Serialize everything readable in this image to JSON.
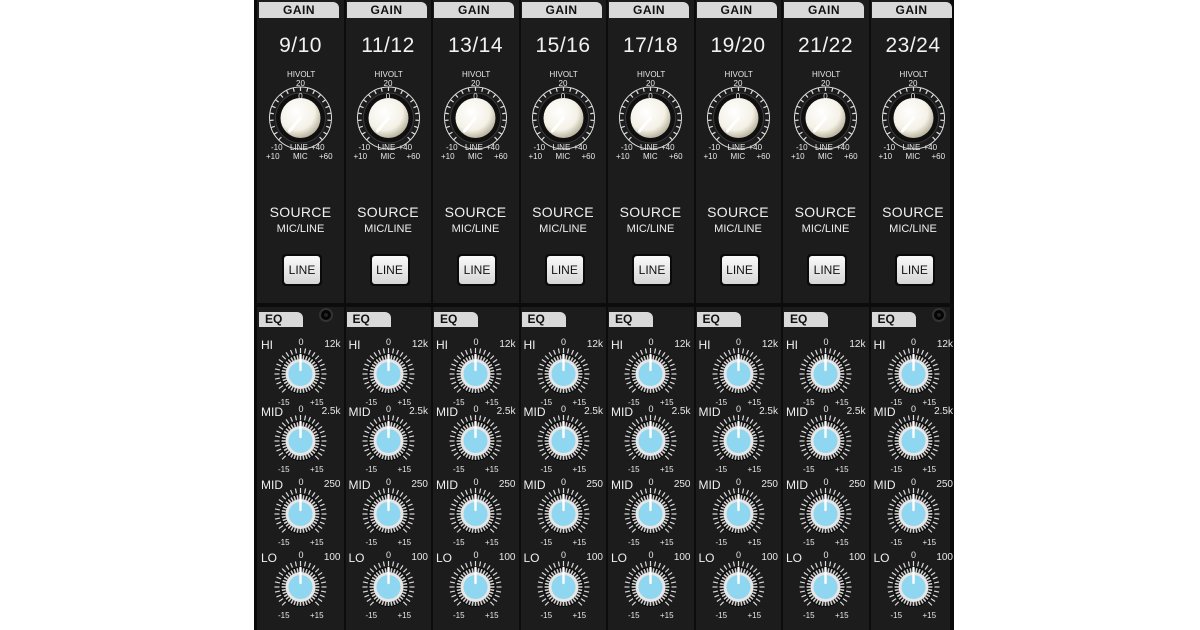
{
  "gain_section": {
    "tab_label": "GAIN",
    "hivolt_label": "HIVOLT",
    "top_value": "20",
    "zero_value": "0",
    "line_min": "-10",
    "line_label": "LINE",
    "line_max": "+40",
    "mic_min": "+10",
    "mic_label": "MIC",
    "mic_max": "+60"
  },
  "source_section": {
    "title": "SOURCE",
    "subtitle": "MIC/LINE",
    "button_label": "LINE"
  },
  "eq_section": {
    "tab_label": "EQ",
    "zero": "0",
    "min": "-15",
    "max": "+15",
    "bands": [
      {
        "name": "HI",
        "freq": "12k"
      },
      {
        "name": "MID",
        "freq": "2.5k"
      },
      {
        "name": "MID",
        "freq": "250"
      },
      {
        "name": "LO",
        "freq": "100"
      }
    ]
  },
  "channels": [
    {
      "name": "9/10"
    },
    {
      "name": "11/12"
    },
    {
      "name": "13/14"
    },
    {
      "name": "15/16"
    },
    {
      "name": "17/18"
    },
    {
      "name": "19/20"
    },
    {
      "name": "21/22"
    },
    {
      "name": "23/24"
    }
  ],
  "colors": {
    "panel": "#1c1c1c",
    "gain_knob": "#f4f1e6",
    "eq_knob": "#8fd6f0",
    "tab": "#d9d9d9"
  }
}
